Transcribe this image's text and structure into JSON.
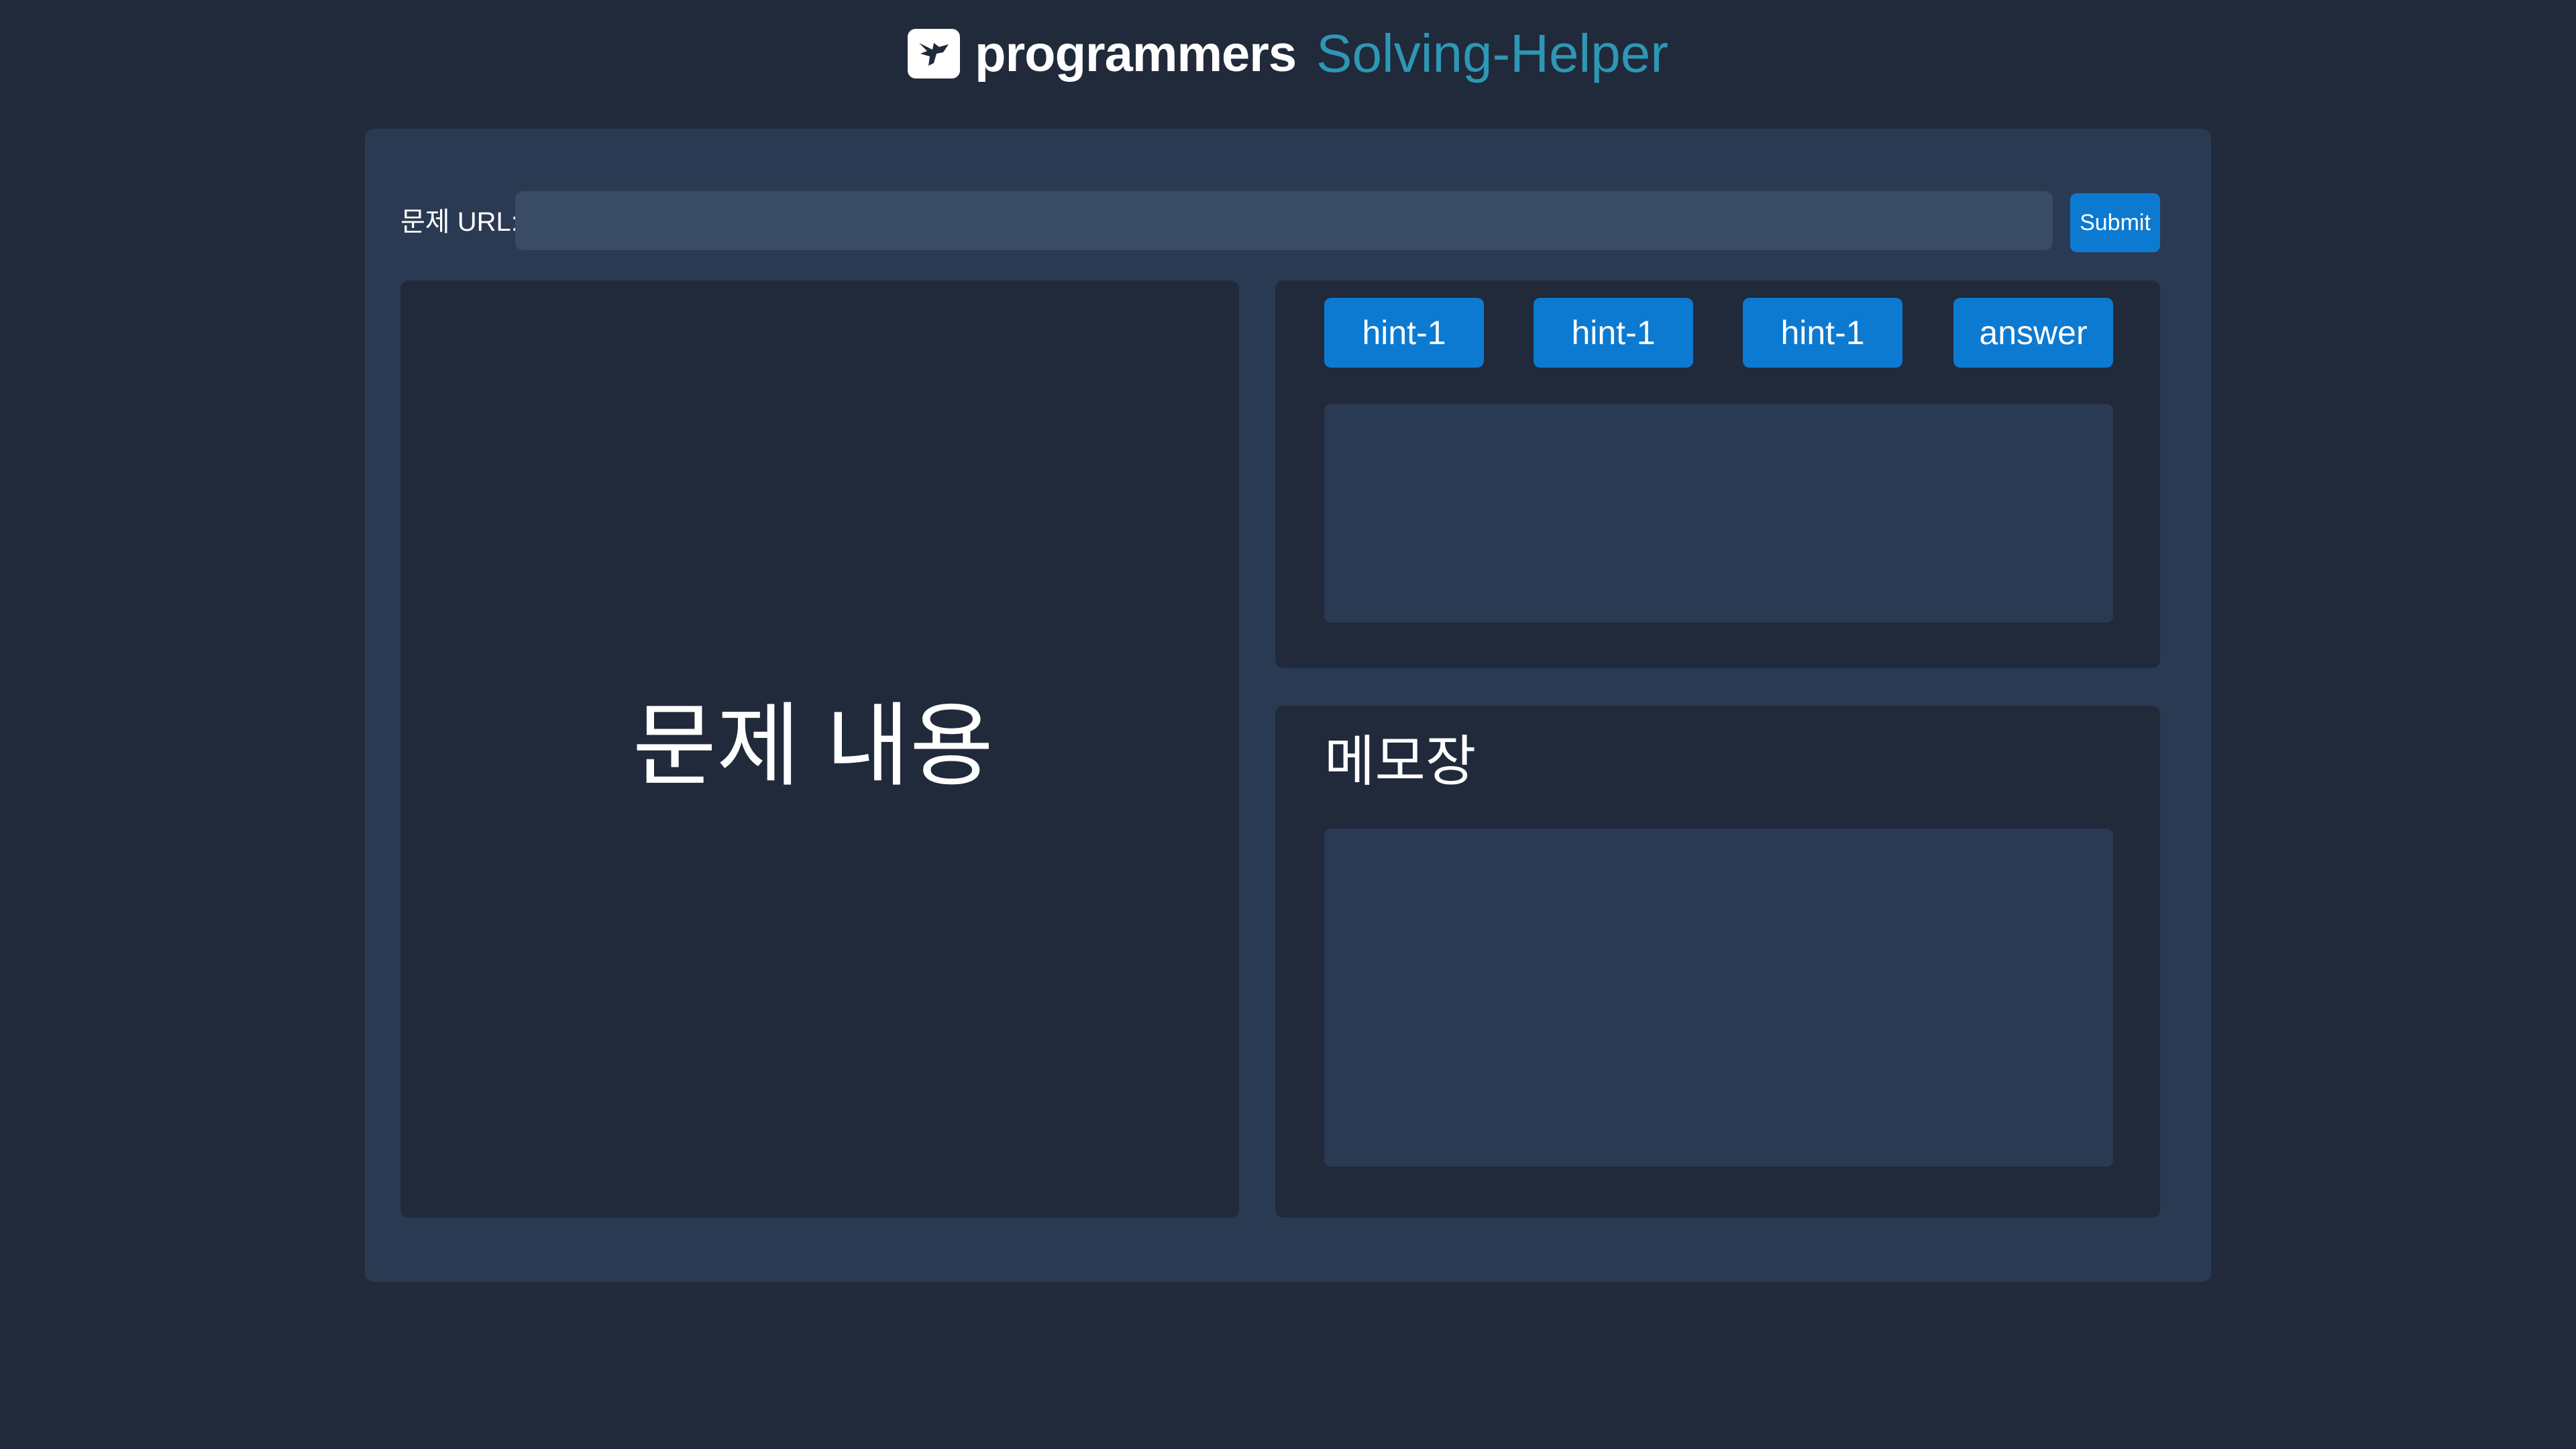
{
  "header": {
    "brand": "programmers",
    "app_title": "Solving-Helper"
  },
  "url_form": {
    "label": "문제 URL:",
    "input_value": "",
    "submit_label": "Submit"
  },
  "problem": {
    "placeholder_text": "문제 내용"
  },
  "hints": {
    "buttons": [
      "hint-1",
      "hint-1",
      "hint-1",
      "answer"
    ],
    "output_text": ""
  },
  "memo": {
    "title": "메모장",
    "content": ""
  },
  "colors": {
    "background": "#202a3b",
    "card": "#2a3a52",
    "input": "#3a4b66",
    "accent_button": "#0d7ad1",
    "title_accent": "#2e97b5"
  }
}
